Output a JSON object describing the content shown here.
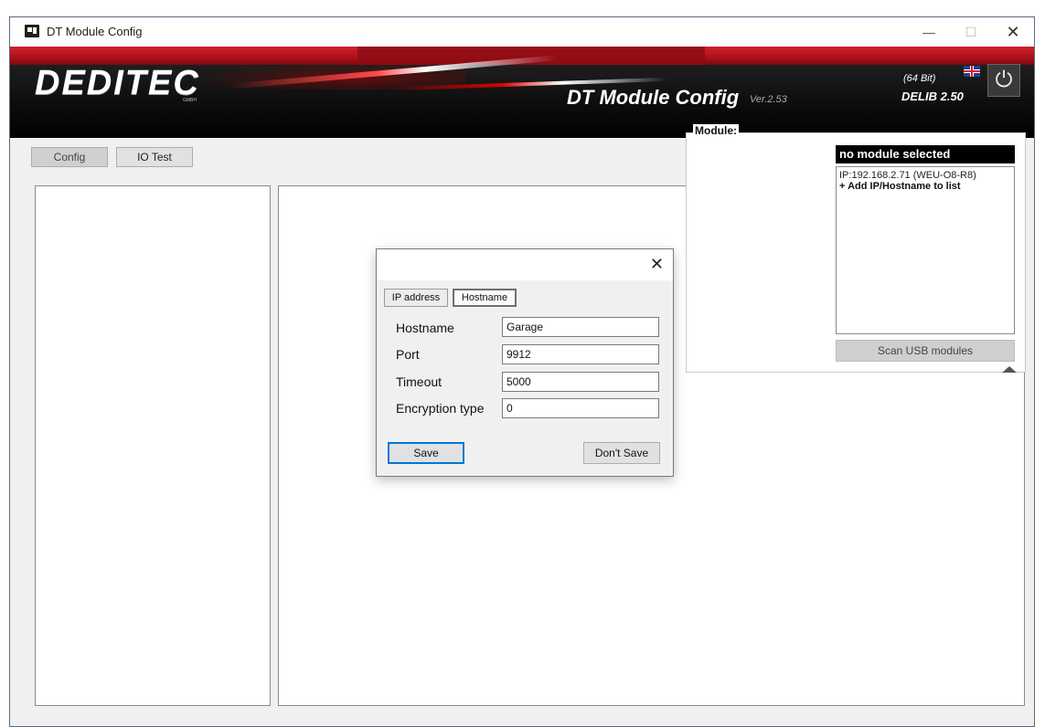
{
  "window": {
    "title": "DT Module Config",
    "minimize": "—",
    "maximize": "☐",
    "close": "✕"
  },
  "banner": {
    "logo": "DEDITEC",
    "logo_sub": "GMBH",
    "app_name": "DT Module Config",
    "version": "Ver.2.53",
    "bits": "(64 Bit)",
    "delib": "DELIB 2.50",
    "power_icon": "⏻"
  },
  "tabs": {
    "config": "Config",
    "io_test": "IO Test"
  },
  "module": {
    "caption": "Module:",
    "selected": "no module selected",
    "list": [
      "IP:192.168.2.71 (WEU-O8-R8)"
    ],
    "add_item": "+ Add IP/Hostname to list",
    "scan_button": "Scan USB modules"
  },
  "dialog": {
    "close": "✕",
    "tab_ip": "IP address",
    "tab_hostname": "Hostname",
    "fields": {
      "hostname_label": "Hostname",
      "hostname_value": "Garage",
      "port_label": "Port",
      "port_value": "9912",
      "timeout_label": "Timeout",
      "timeout_value": "5000",
      "encryption_label": "Encryption type",
      "encryption_value": "0"
    },
    "save": "Save",
    "dont_save": "Don't Save"
  },
  "colors": {
    "banner_red": "#c01820",
    "banner_black": "#111111",
    "focus_blue": "#0078d7"
  }
}
